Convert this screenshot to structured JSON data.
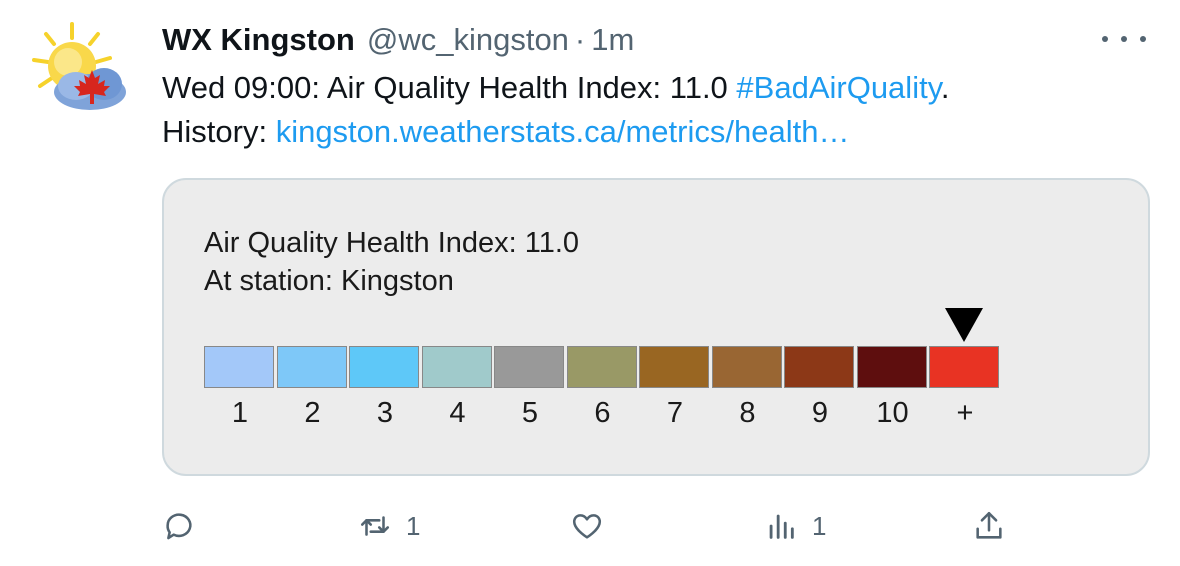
{
  "tweet": {
    "author_name": "WX Kingston",
    "handle": "@wc_kingston",
    "separator": "·",
    "time": "1m",
    "text_prefix": "Wed 09:00: Air Quality Health Index: 11.0 ",
    "hashtag": "#BadAirQuality",
    "text_suffix": ".",
    "history_label": "History: ",
    "link_text": "kingston.weatherstats.ca/metrics/health…"
  },
  "card": {
    "line1": "Air Quality Health Index: 11.0",
    "line2": "At station: Kingston",
    "scale": [
      {
        "label": "1",
        "color": "#a3c8f9"
      },
      {
        "label": "2",
        "color": "#7ec8f8"
      },
      {
        "label": "3",
        "color": "#5ec8f8"
      },
      {
        "label": "4",
        "color": "#a0cacb"
      },
      {
        "label": "5",
        "color": "#999999"
      },
      {
        "label": "6",
        "color": "#999966"
      },
      {
        "label": "7",
        "color": "#996622"
      },
      {
        "label": "8",
        "color": "#996633"
      },
      {
        "label": "9",
        "color": "#8c3817"
      },
      {
        "label": "10",
        "color": "#5e0e0e"
      },
      {
        "label": "+",
        "color": "#e83323"
      }
    ],
    "marker_index": 10
  },
  "actions": {
    "reply_icon": "reply-icon",
    "retweet_icon": "retweet-icon",
    "retweet_count": "1",
    "like_icon": "heart-icon",
    "views_icon": "views-icon",
    "views_count": "1",
    "share_icon": "share-icon"
  },
  "colors": {
    "link": "#1d9bf0",
    "muted": "#536471",
    "card_background": "#ececec",
    "card_border": "#cfd9de"
  }
}
